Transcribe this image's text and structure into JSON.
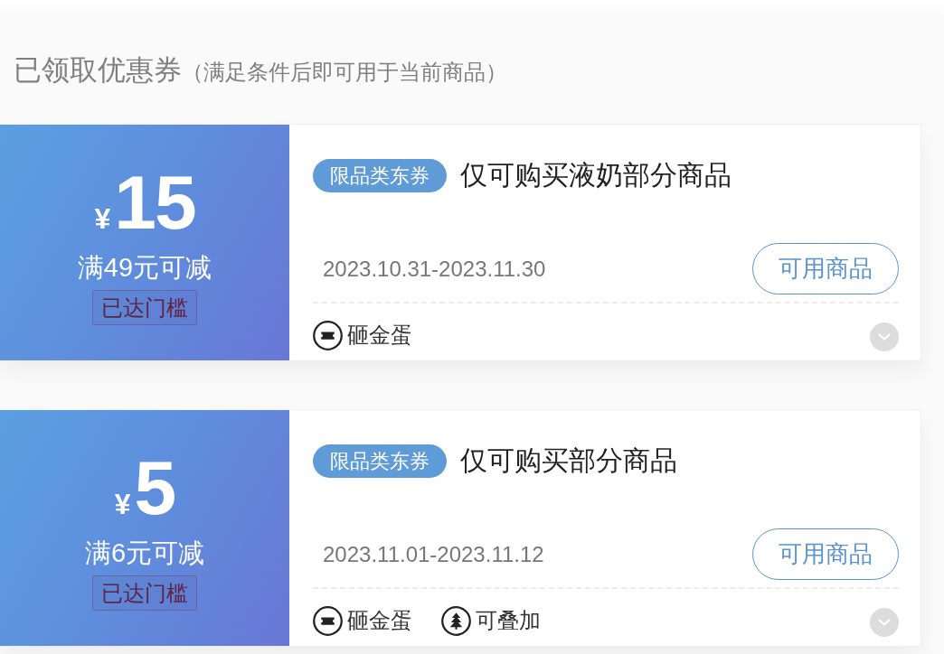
{
  "section": {
    "title": "已领取优惠券",
    "note": "（满足条件后即可用于当前商品）"
  },
  "coupons": [
    {
      "currency": "¥",
      "amount": "15",
      "condition": "满49元可减",
      "threshold_badge": "已达门槛",
      "tag": "限品类东券",
      "title": "仅可购买液奶部分商品",
      "validity": "2023.10.31-2023.11.30",
      "action": "可用商品",
      "features": [
        {
          "kind": "ticket",
          "label": "砸金蛋"
        }
      ],
      "expanded": false
    },
    {
      "currency": "¥",
      "amount": "5",
      "condition": "满6元可减",
      "threshold_badge": "已达门槛",
      "tag": "限品类东券",
      "title": "仅可购买部分商品",
      "validity": "2023.11.01-2023.11.12",
      "action": "可用商品",
      "features": [
        {
          "kind": "ticket",
          "label": "砸金蛋"
        },
        {
          "kind": "stack",
          "label": "可叠加"
        }
      ],
      "expanded": false
    }
  ]
}
